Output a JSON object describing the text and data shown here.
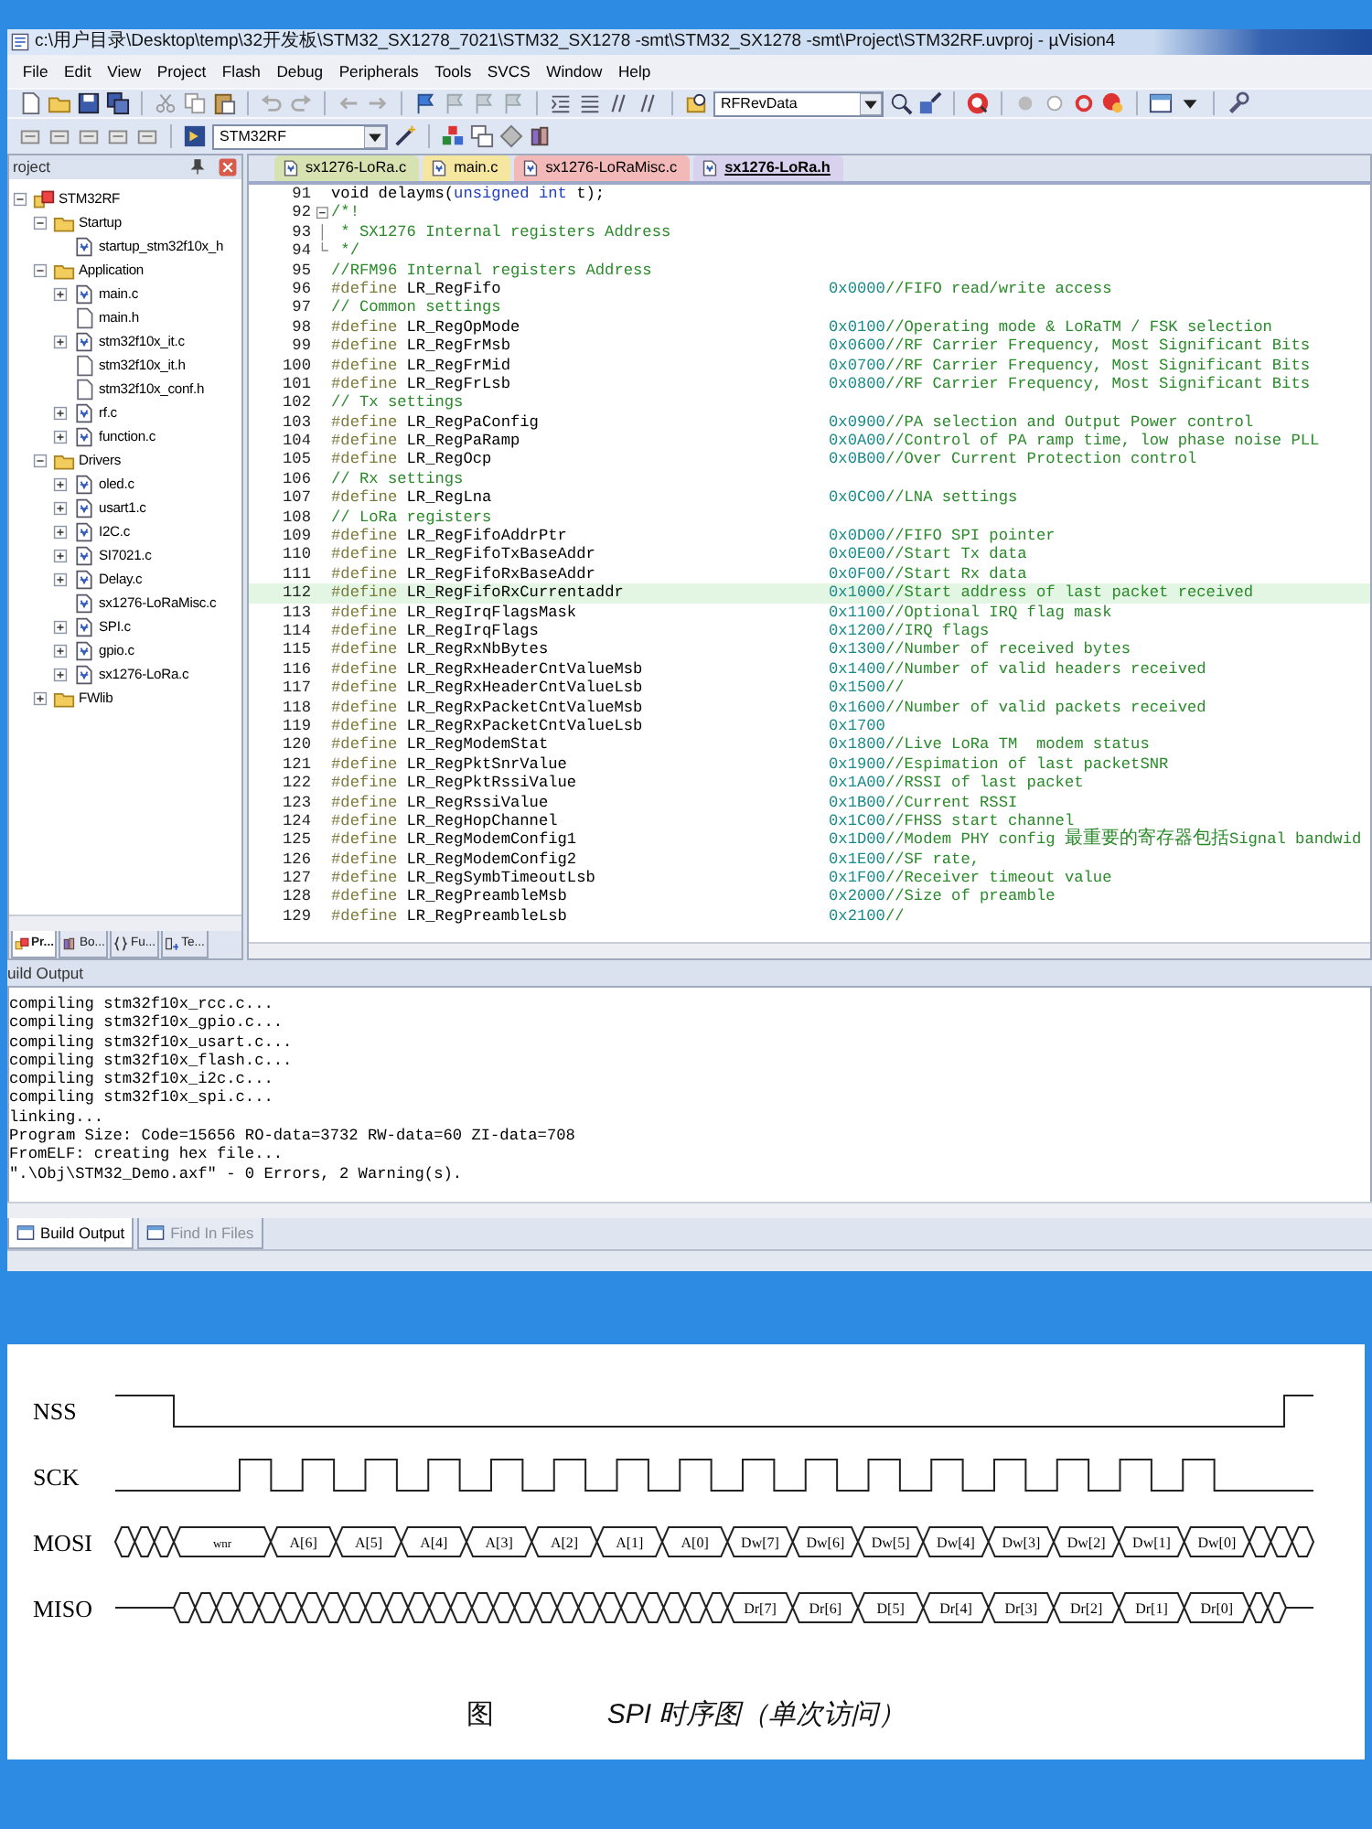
{
  "window": {
    "title": "c:\\用户目录\\Desktop\\temp\\32开发板\\STM32_SX1278_7021\\STM32_SX1278 -smt\\STM32_SX1278 -smt\\Project\\STM32RF.uvproj - µVision4"
  },
  "menu": [
    "File",
    "Edit",
    "View",
    "Project",
    "Flash",
    "Debug",
    "Peripherals",
    "Tools",
    "SVCS",
    "Window",
    "Help"
  ],
  "toolbar": {
    "target": "RFRevData",
    "project": "STM32RF"
  },
  "project_panel": {
    "title": "roject",
    "tree": [
      {
        "label": "STM32RF",
        "kind": "project",
        "expanded": true,
        "children": [
          {
            "label": "Startup",
            "kind": "folder",
            "expanded": true,
            "children": [
              {
                "label": "startup_stm32f10x_h",
                "kind": "source"
              }
            ]
          },
          {
            "label": "Application",
            "kind": "folder",
            "expanded": true,
            "children": [
              {
                "label": "main.c",
                "kind": "source",
                "expanded": false
              },
              {
                "label": "main.h",
                "kind": "header"
              },
              {
                "label": "stm32f10x_it.c",
                "kind": "source",
                "expanded": false
              },
              {
                "label": "stm32f10x_it.h",
                "kind": "header"
              },
              {
                "label": "stm32f10x_conf.h",
                "kind": "header"
              },
              {
                "label": "rf.c",
                "kind": "source",
                "expanded": false
              },
              {
                "label": "function.c",
                "kind": "source",
                "expanded": false
              }
            ]
          },
          {
            "label": "Drivers",
            "kind": "folder",
            "expanded": true,
            "children": [
              {
                "label": "oled.c",
                "kind": "source",
                "expanded": false
              },
              {
                "label": "usart1.c",
                "kind": "source",
                "expanded": false
              },
              {
                "label": "I2C.c",
                "kind": "source",
                "expanded": false
              },
              {
                "label": "SI7021.c",
                "kind": "source",
                "expanded": false
              },
              {
                "label": "Delay.c",
                "kind": "source",
                "expanded": false
              },
              {
                "label": "sx1276-LoRaMisc.c",
                "kind": "source"
              },
              {
                "label": "SPI.c",
                "kind": "source",
                "expanded": false
              },
              {
                "label": "gpio.c",
                "kind": "source",
                "expanded": false
              },
              {
                "label": "sx1276-LoRa.c",
                "kind": "source",
                "expanded": false
              }
            ]
          },
          {
            "label": "FWlib",
            "kind": "folder",
            "expanded": false
          }
        ]
      }
    ],
    "tabs": [
      {
        "label": "Pr...",
        "kind": "project",
        "selected": true
      },
      {
        "label": "Bo...",
        "kind": "books",
        "selected": false
      },
      {
        "label": "Fu...",
        "kind": "functions",
        "selected": false
      },
      {
        "label": "Te...",
        "kind": "templates",
        "selected": false
      }
    ]
  },
  "editor": {
    "tabs": [
      {
        "label": "sx1276-LoRa.c",
        "color": "#d6e3b0",
        "selected": false
      },
      {
        "label": "main.c",
        "color": "#f5e6a0",
        "selected": false
      },
      {
        "label": "sx1276-LoRaMisc.c",
        "color": "#f3b8b8",
        "selected": false
      },
      {
        "label": "sx1276-LoRa.h",
        "color": "#d9d2ee",
        "selected": true
      }
    ],
    "lines": [
      {
        "number": "91",
        "kind": "code",
        "segments": [
          {
            "text": "void delayms(",
            "kind": "plain"
          },
          {
            "text": "unsigned int",
            "kind": "keyword"
          },
          {
            "text": " t);",
            "kind": "plain"
          }
        ],
        "highlighted": false
      },
      {
        "number": "92",
        "kind": "block_comment_start",
        "text": "/*!",
        "highlighted": false
      },
      {
        "number": "93",
        "kind": "block_comment",
        "text": " * SX1276 Internal registers Address",
        "highlighted": false
      },
      {
        "number": "94",
        "kind": "block_comment_end",
        "text": " */",
        "highlighted": false
      },
      {
        "number": "95",
        "kind": "comment",
        "text": "//RFM96 Internal registers Address",
        "highlighted": false
      },
      {
        "number": "96",
        "kind": "define",
        "directive": "#define",
        "name": "LR_RegFifo",
        "value": "0x0000",
        "comment": "//FIFO read/write access",
        "highlighted": false
      },
      {
        "number": "97",
        "kind": "comment",
        "text": "// Common settings",
        "highlighted": false
      },
      {
        "number": "98",
        "kind": "define",
        "directive": "#define",
        "name": "LR_RegOpMode",
        "value": "0x0100",
        "comment": "//Operating mode & LoRaTM / FSK selection",
        "highlighted": false
      },
      {
        "number": "99",
        "kind": "define",
        "directive": "#define",
        "name": "LR_RegFrMsb",
        "value": "0x0600",
        "comment": "//RF Carrier Frequency, Most Significant Bits",
        "highlighted": false
      },
      {
        "number": "100",
        "kind": "define",
        "directive": "#define",
        "name": "LR_RegFrMid",
        "value": "0x0700",
        "comment": "//RF Carrier Frequency, Most Significant Bits",
        "highlighted": false
      },
      {
        "number": "101",
        "kind": "define",
        "directive": "#define",
        "name": "LR_RegFrLsb",
        "value": "0x0800",
        "comment": "//RF Carrier Frequency, Most Significant Bits",
        "highlighted": false
      },
      {
        "number": "102",
        "kind": "comment",
        "text": "// Tx settings",
        "highlighted": false
      },
      {
        "number": "103",
        "kind": "define",
        "directive": "#define",
        "name": "LR_RegPaConfig",
        "value": "0x0900",
        "comment": "//PA selection and Output Power control",
        "highlighted": false
      },
      {
        "number": "104",
        "kind": "define",
        "directive": "#define",
        "name": "LR_RegPaRamp",
        "value": "0x0A00",
        "comment": "//Control of PA ramp time, low phase noise PLL",
        "highlighted": false
      },
      {
        "number": "105",
        "kind": "define",
        "directive": "#define",
        "name": "LR_RegOcp",
        "value": "0x0B00",
        "comment": "//Over Current Protection control",
        "highlighted": false
      },
      {
        "number": "106",
        "kind": "comment",
        "text": "// Rx settings",
        "highlighted": false
      },
      {
        "number": "107",
        "kind": "define",
        "directive": "#define",
        "name": "LR_RegLna",
        "value": "0x0C00",
        "comment": "//LNA settings",
        "highlighted": false
      },
      {
        "number": "108",
        "kind": "comment",
        "text": "// LoRa registers",
        "highlighted": false
      },
      {
        "number": "109",
        "kind": "define",
        "directive": "#define",
        "name": "LR_RegFifoAddrPtr",
        "value": "0x0D00",
        "comment": "//FIFO SPI pointer",
        "highlighted": false
      },
      {
        "number": "110",
        "kind": "define",
        "directive": "#define",
        "name": "LR_RegFifoTxBaseAddr",
        "value": "0x0E00",
        "comment": "//Start Tx data",
        "highlighted": false
      },
      {
        "number": "111",
        "kind": "define",
        "directive": "#define",
        "name": "LR_RegFifoRxBaseAddr",
        "value": "0x0F00",
        "comment": "//Start Rx data",
        "highlighted": false
      },
      {
        "number": "112",
        "kind": "define",
        "directive": "#define",
        "name": "LR_RegFifoRxCurrentaddr",
        "value": "0x1000",
        "comment": "//Start address of last packet received",
        "highlighted": true
      },
      {
        "number": "113",
        "kind": "define",
        "directive": "#define",
        "name": "LR_RegIrqFlagsMask",
        "value": "0x1100",
        "comment": "//Optional IRQ flag mask",
        "highlighted": false
      },
      {
        "number": "114",
        "kind": "define",
        "directive": "#define",
        "name": "LR_RegIrqFlags",
        "value": "0x1200",
        "comment": "//IRQ flags",
        "highlighted": false
      },
      {
        "number": "115",
        "kind": "define",
        "directive": "#define",
        "name": "LR_RegRxNbBytes",
        "value": "0x1300",
        "comment": "//Number of received bytes",
        "highlighted": false
      },
      {
        "number": "116",
        "kind": "define",
        "directive": "#define",
        "name": "LR_RegRxHeaderCntValueMsb",
        "value": "0x1400",
        "comment": "//Number of valid headers received",
        "highlighted": false
      },
      {
        "number": "117",
        "kind": "define",
        "directive": "#define",
        "name": "LR_RegRxHeaderCntValueLsb",
        "value": "0x1500",
        "comment": "//",
        "highlighted": false
      },
      {
        "number": "118",
        "kind": "define",
        "directive": "#define",
        "name": "LR_RegRxPacketCntValueMsb",
        "value": "0x1600",
        "comment": "//Number of valid packets received",
        "highlighted": false
      },
      {
        "number": "119",
        "kind": "define",
        "directive": "#define",
        "name": "LR_RegRxPacketCntValueLsb",
        "value": "0x1700",
        "highlighted": false
      },
      {
        "number": "120",
        "kind": "define",
        "directive": "#define",
        "name": "LR_RegModemStat",
        "value": "0x1800",
        "comment": "//Live LoRa TM  modem status",
        "highlighted": false
      },
      {
        "number": "121",
        "kind": "define",
        "directive": "#define",
        "name": "LR_RegPktSnrValue",
        "value": "0x1900",
        "comment": "//Espimation of last packetSNR",
        "highlighted": false
      },
      {
        "number": "122",
        "kind": "define",
        "directive": "#define",
        "name": "LR_RegPktRssiValue",
        "value": "0x1A00",
        "comment": "//RSSI of last packet",
        "highlighted": false
      },
      {
        "number": "123",
        "kind": "define",
        "directive": "#define",
        "name": "LR_RegRssiValue",
        "value": "0x1B00",
        "comment": "//Current RSSI",
        "highlighted": false
      },
      {
        "number": "124",
        "kind": "define",
        "directive": "#define",
        "name": "LR_RegHopChannel",
        "value": "0x1C00",
        "comment": "//FHSS start channel",
        "highlighted": false
      },
      {
        "number": "125",
        "kind": "define",
        "directive": "#define",
        "name": "LR_RegModemConfig1",
        "value": "0x1D00",
        "comment": "//Modem PHY config 最重要的寄存器包括Signal bandwid",
        "highlighted": false
      },
      {
        "number": "126",
        "kind": "define",
        "directive": "#define",
        "name": "LR_RegModemConfig2",
        "value": "0x1E00",
        "comment": "//SF rate,",
        "highlighted": false
      },
      {
        "number": "127",
        "kind": "define",
        "directive": "#define",
        "name": "LR_RegSymbTimeoutLsb",
        "value": "0x1F00",
        "comment": "//Receiver timeout value",
        "highlighted": false
      },
      {
        "number": "128",
        "kind": "define",
        "directive": "#define",
        "name": "LR_RegPreambleMsb",
        "value": "0x2000",
        "comment": "//Size of preamble",
        "highlighted": false
      },
      {
        "number": "129",
        "kind": "define",
        "directive": "#define",
        "name": "LR_RegPreambleLsb",
        "value": "0x2100",
        "comment": "//",
        "highlighted": false
      }
    ]
  },
  "build_output": {
    "title": "uild Output",
    "lines": [
      "compiling stm32f10x_rcc.c...",
      "compiling stm32f10x_gpio.c...",
      "compiling stm32f10x_usart.c...",
      "compiling stm32f10x_flash.c...",
      "compiling stm32f10x_i2c.c...",
      "compiling stm32f10x_spi.c...",
      "linking...",
      "Program Size: Code=15656 RO-data=3732 RW-data=60 ZI-data=708",
      "FromELF: creating hex file...",
      "\".\\Obj\\STM32_Demo.axf\" - 0 Errors, 2 Warning(s)."
    ],
    "tabs": [
      {
        "label": "Build Output",
        "selected": true
      },
      {
        "label": "Find In Files",
        "selected": false
      }
    ]
  },
  "figure": {
    "signals": [
      {
        "name": "NSS",
        "kind": "select"
      },
      {
        "name": "SCK",
        "kind": "clock"
      },
      {
        "name": "MOSI",
        "kind": "write_bus",
        "cells": [
          "wnr",
          "A[6]",
          "A[5]",
          "A[4]",
          "A[3]",
          "A[2]",
          "A[1]",
          "A[0]",
          "Dw[7]",
          "Dw[6]",
          "Dw[5]",
          "Dw[4]",
          "Dw[3]",
          "Dw[2]",
          "Dw[1]",
          "Dw[0]"
        ]
      },
      {
        "name": "MISO",
        "kind": "read_bus",
        "cells": [
          "Dr[7]",
          "Dr[6]",
          "D[5]",
          "Dr[4]",
          "Dr[3]",
          "Dr[2]",
          "Dr[1]",
          "Dr[0]"
        ]
      }
    ],
    "caption_prefix": "图",
    "caption": "SPI 时序图（单次访问）"
  }
}
